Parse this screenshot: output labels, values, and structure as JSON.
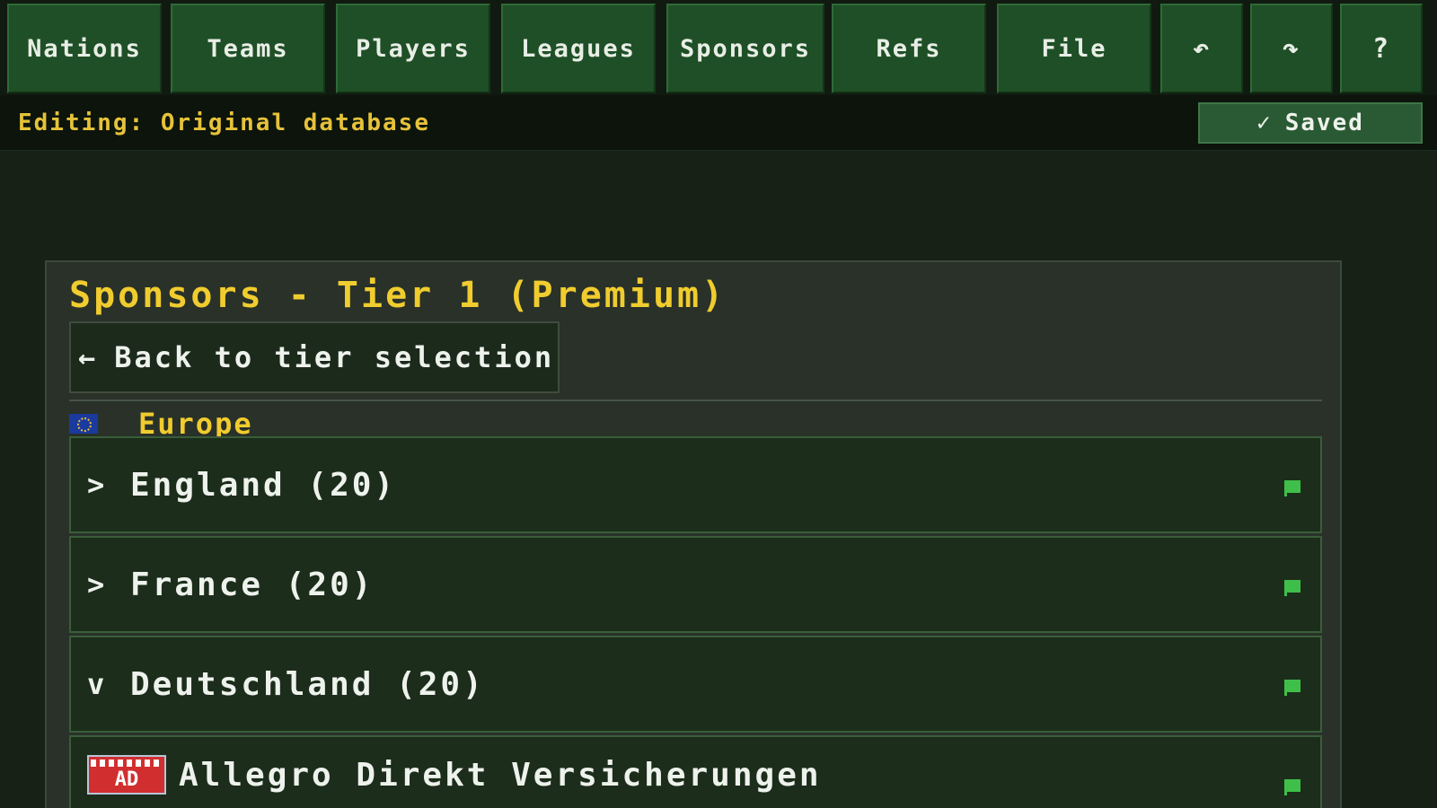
{
  "nav": {
    "items": [
      {
        "label": "Nations"
      },
      {
        "label": "Teams"
      },
      {
        "label": "Players"
      },
      {
        "label": "Leagues"
      },
      {
        "label": "Sponsors"
      },
      {
        "label": "Refs"
      },
      {
        "label": "File"
      },
      {
        "icon": "undo-icon",
        "glyph": "↶"
      },
      {
        "icon": "redo-icon",
        "glyph": "↷"
      },
      {
        "icon": "help-icon",
        "glyph": "?"
      }
    ]
  },
  "status": {
    "editing": "Editing: Original database",
    "saved_check": "✓",
    "saved_label": "Saved"
  },
  "panel": {
    "title": "Sponsors - Tier 1 (Premium)",
    "back_arrow": "←",
    "back_label": "Back to tier selection",
    "region": {
      "flag": "eu-flag-icon",
      "label": "Europe"
    },
    "countries": [
      {
        "chevron": ">",
        "label": "England (20)",
        "expanded": false
      },
      {
        "chevron": ">",
        "label": "France (20)",
        "expanded": false
      },
      {
        "chevron": "v",
        "label": "Deutschland (20)",
        "expanded": true
      }
    ],
    "sponsors": [
      {
        "badge_text": "AD",
        "name": "Allegro Direkt Versicherungen"
      }
    ]
  },
  "colors": {
    "accent_yellow": "#f0cc2e",
    "button_green": "#1f4f26",
    "flag_green": "#3fbf4a",
    "background": "#172116"
  }
}
